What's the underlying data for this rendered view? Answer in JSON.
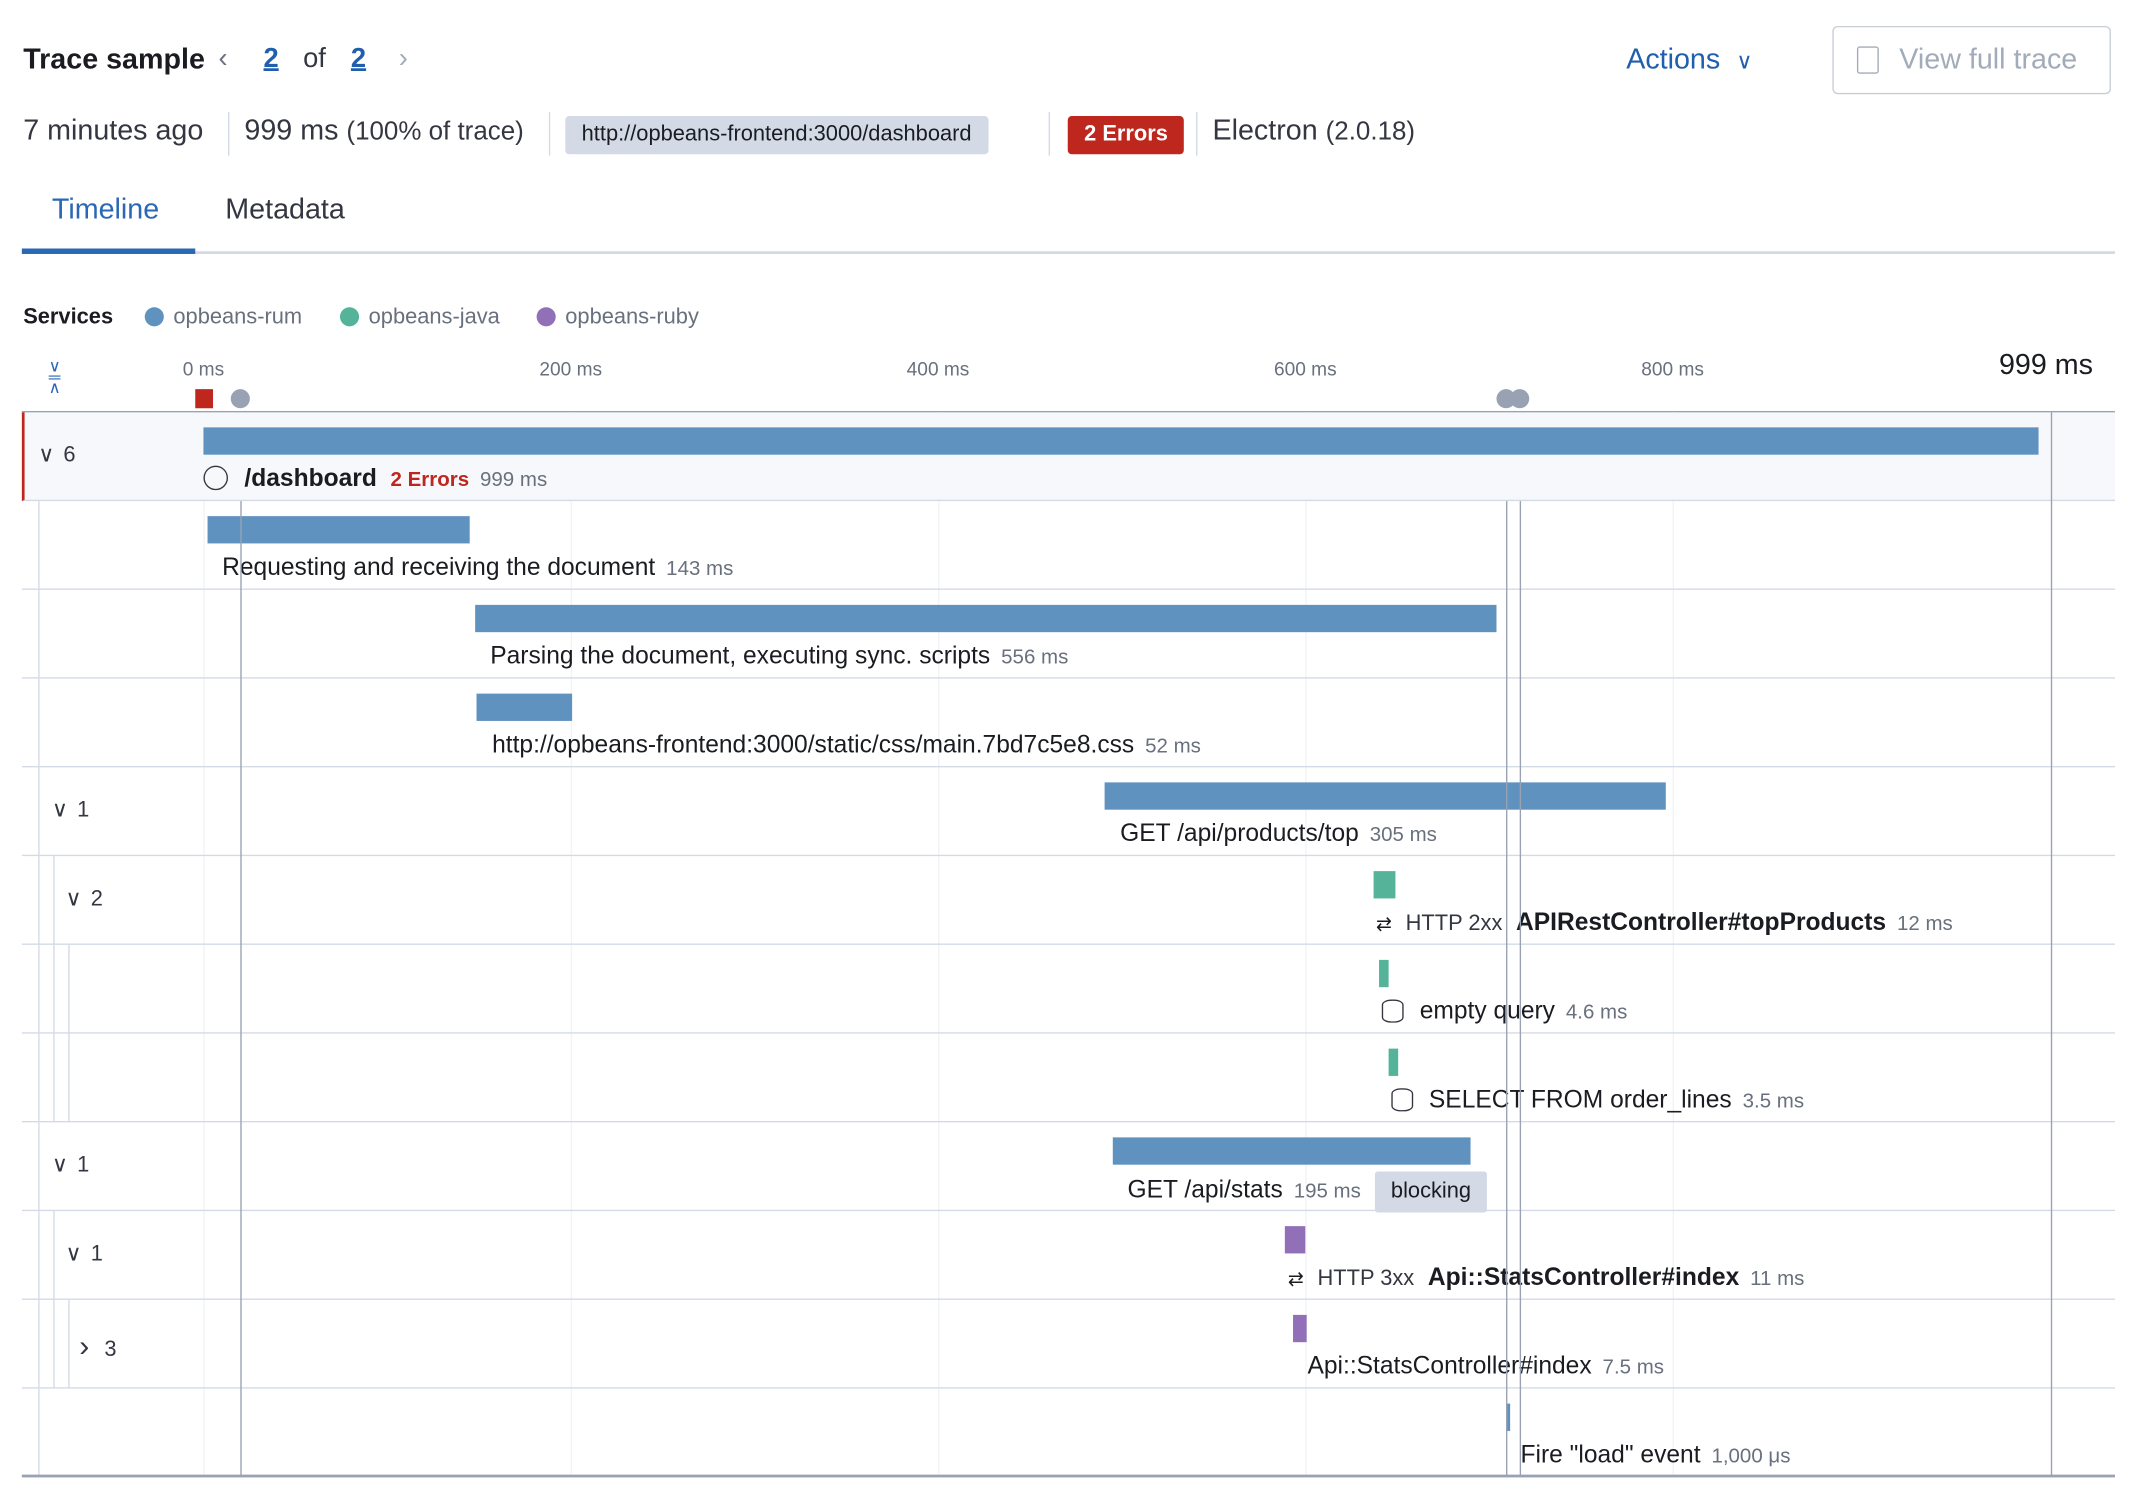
{
  "header": {
    "title": "Trace sample",
    "current": "2",
    "of": "of",
    "total": "2",
    "actions_label": "Actions",
    "view_full_trace_label": "View full trace",
    "age": "7 minutes ago",
    "duration": "999 ms",
    "duration_pct": "(100% of trace)",
    "url": "http://opbeans-frontend:3000/dashboard",
    "errors_badge": "2 Errors",
    "agent": "Electron",
    "agent_version": "(2.0.18)"
  },
  "tabs": [
    {
      "label": "Timeline",
      "active": true
    },
    {
      "label": "Metadata",
      "active": false
    }
  ],
  "services": {
    "label": "Services",
    "items": [
      {
        "name": "opbeans-rum",
        "color": "#6092c0"
      },
      {
        "name": "opbeans-java",
        "color": "#54b399"
      },
      {
        "name": "opbeans-ruby",
        "color": "#9170b8"
      }
    ]
  },
  "axis": {
    "ticks": [
      {
        "ms": 0,
        "label": "0 ms"
      },
      {
        "ms": 200,
        "label": "200 ms"
      },
      {
        "ms": 400,
        "label": "400 ms"
      },
      {
        "ms": 600,
        "label": "600 ms"
      },
      {
        "ms": 800,
        "label": "800 ms"
      }
    ],
    "end_label": "999 ms",
    "max_ms": 999
  },
  "colors": {
    "rum": "#6092c0",
    "java": "#54b399",
    "ruby": "#9170b8",
    "error": "#bd271e",
    "mark": "#98a2b3"
  },
  "rows": [
    {
      "name": "/dashboard",
      "bold": true,
      "icon": "globe-icon",
      "errors": "2 Errors",
      "duration": "999 ms",
      "start": 0,
      "dur": 999,
      "service": "rum",
      "level": 0,
      "toggle": "6",
      "expanded": true,
      "root": true
    },
    {
      "name": "Requesting and receiving the document",
      "duration": "143 ms",
      "start": 2,
      "dur": 143,
      "service": "rum",
      "level": 1
    },
    {
      "name": "Parsing the document, executing sync. scripts",
      "duration": "556 ms",
      "start": 148,
      "dur": 556,
      "service": "rum",
      "level": 1
    },
    {
      "name": "http://opbeans-frontend:3000/static/css/main.7bd7c5e8.css",
      "duration": "52 ms",
      "start": 149,
      "dur": 52,
      "service": "rum",
      "level": 1
    },
    {
      "name": "GET /api/products/top",
      "duration": "305 ms",
      "start": 491,
      "dur": 305,
      "service": "rum",
      "level": 1,
      "toggle": "1",
      "expanded": true
    },
    {
      "name": "APIRestController#topProducts",
      "bold": true,
      "prefix": "HTTP 2xx",
      "icon": "exit-span-icon",
      "duration": "12 ms",
      "start": 637,
      "dur": 12,
      "service": "java",
      "level": 2,
      "toggle": "2",
      "expanded": true
    },
    {
      "name": "empty query",
      "icon": "database-icon",
      "duration": "4.6 ms",
      "start": 640,
      "dur": 4.6,
      "service": "java",
      "level": 3
    },
    {
      "name": "SELECT FROM order_lines",
      "icon": "database-icon",
      "duration": "3.5 ms",
      "start": 645,
      "dur": 3.5,
      "service": "java",
      "level": 3
    },
    {
      "name": "GET /api/stats",
      "duration": "195 ms",
      "badge": "blocking",
      "start": 495,
      "dur": 195,
      "service": "rum",
      "level": 1,
      "toggle": "1",
      "expanded": true
    },
    {
      "name": "Api::StatsController#index",
      "bold": true,
      "prefix": "HTTP 3xx",
      "icon": "exit-span-icon",
      "duration": "11 ms",
      "start": 589,
      "dur": 11,
      "service": "ruby",
      "level": 2,
      "toggle": "1",
      "expanded": true
    },
    {
      "name": "Api::StatsController#index",
      "duration": "7.5 ms",
      "start": 593,
      "dur": 7.5,
      "service": "ruby",
      "level": 3,
      "toggle": "3",
      "expanded": false
    },
    {
      "name": "Fire \"load\" event",
      "duration": "1,000 μs",
      "start": 709,
      "dur": 1,
      "service": "rum",
      "level": 1
    }
  ],
  "marks": [
    {
      "type": "error",
      "ms": 0
    },
    {
      "type": "agent",
      "ms": 20
    },
    {
      "type": "agent",
      "ms": 709
    },
    {
      "type": "agent",
      "ms": 717
    }
  ]
}
